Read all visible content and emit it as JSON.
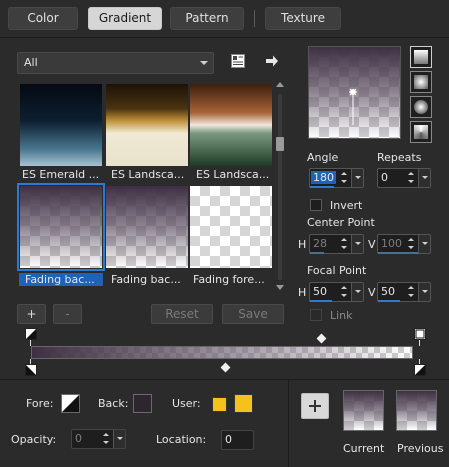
{
  "tabs": [
    {
      "label": "Color",
      "active": false
    },
    {
      "label": "Gradient",
      "active": true
    },
    {
      "label": "Pattern",
      "active": false
    },
    {
      "label": "Texture",
      "active": false
    }
  ],
  "category_dropdown": {
    "value": "All"
  },
  "gallery": {
    "items": [
      {
        "label": "ES Emerald ...",
        "selected": false
      },
      {
        "label": "ES Landsca...",
        "selected": false
      },
      {
        "label": "ES Landsca...",
        "selected": false
      },
      {
        "label": "Fading bac...",
        "selected": true
      },
      {
        "label": "Fading bac...",
        "selected": false
      },
      {
        "label": "Fading fore...",
        "selected": false
      }
    ]
  },
  "gallery_buttons": {
    "add": "+",
    "remove": "-",
    "reset": "Reset",
    "save": "Save"
  },
  "angle": {
    "label": "Angle",
    "value": "180"
  },
  "repeats": {
    "label": "Repeats",
    "value": "0"
  },
  "invert": {
    "label": "Invert",
    "checked": false
  },
  "center_point": {
    "label": "Center Point",
    "h_label": "H",
    "h_value": "28",
    "v_label": "V",
    "v_value": "100"
  },
  "focal_point": {
    "label": "Focal Point",
    "h_label": "H",
    "h_value": "50",
    "v_label": "V",
    "v_value": "50"
  },
  "link": {
    "label": "Link",
    "checked": false
  },
  "bottom": {
    "fore_label": "Fore:",
    "back_label": "Back:",
    "user_label": "User:",
    "opacity_label": "Opacity:",
    "opacity_value": "0",
    "location_label": "Location:",
    "location_value": "0",
    "current_label": "Current",
    "previous_label": "Previous"
  },
  "colors": {
    "gradient_dark": "#3e3042",
    "accent_blue": "#2a7bd4",
    "user_yellow": "#f4c21a",
    "back_color": "#2f2530"
  }
}
